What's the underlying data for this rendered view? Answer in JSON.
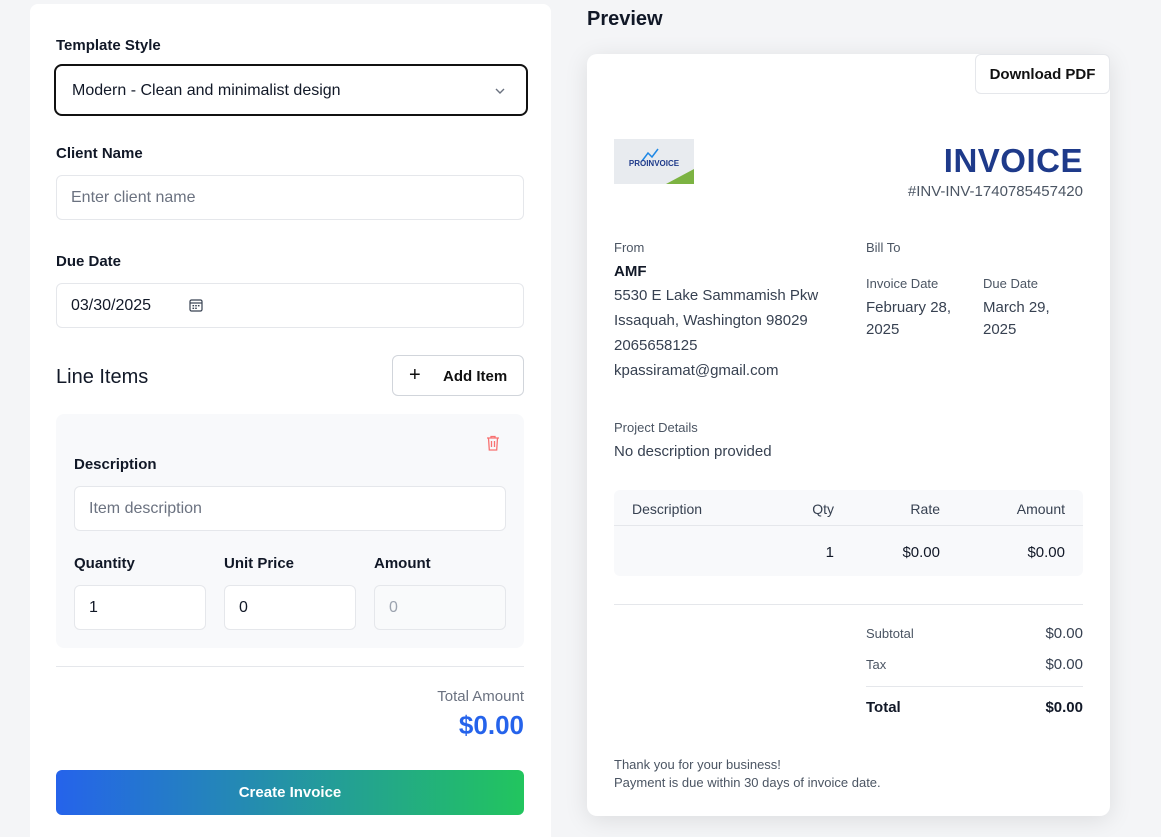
{
  "form": {
    "template_label": "Template Style",
    "template_value": "Modern - Clean and minimalist design",
    "client_label": "Client Name",
    "client_placeholder": "Enter client name",
    "due_label": "Due Date",
    "due_value": "03/30/2025",
    "line_items_title": "Line Items",
    "add_item_label": "Add Item",
    "item": {
      "description_label": "Description",
      "description_placeholder": "Item description",
      "quantity_label": "Quantity",
      "quantity_value": "1",
      "unit_price_label": "Unit Price",
      "unit_price_value": "0",
      "amount_label": "Amount",
      "amount_value": "0"
    },
    "total_label": "Total Amount",
    "total_value": "$0.00",
    "create_label": "Create Invoice"
  },
  "preview": {
    "title": "Preview",
    "download_label": "Download PDF",
    "invoice_title": "INVOICE",
    "invoice_number": "#INV-INV-1740785457420",
    "from_label": "From",
    "from_name": "AMF",
    "from_address1": "5530 E Lake Sammamish Pkw",
    "from_address2": "Issaquah, Washington 98029",
    "from_phone": "2065658125",
    "from_email": "kpassiramat@gmail.com",
    "bill_to_label": "Bill To",
    "invoice_date_label": "Invoice Date",
    "invoice_date_line1": "February 28,",
    "invoice_date_line2": "2025",
    "due_date_label": "Due Date",
    "due_date_line1": "March 29,",
    "due_date_line2": "2025",
    "project_label": "Project Details",
    "project_text": "No description provided",
    "table": {
      "headers": [
        "Description",
        "Qty",
        "Rate",
        "Amount"
      ],
      "rows": [
        {
          "description": "",
          "qty": "1",
          "rate": "$0.00",
          "amount": "$0.00"
        }
      ]
    },
    "subtotal_label": "Subtotal",
    "subtotal_value": "$0.00",
    "tax_label": "Tax",
    "tax_value": "$0.00",
    "total_label": "Total",
    "total_value": "$0.00",
    "footer_line1": "Thank you for your business!",
    "footer_line2": "Payment is due within 30 days of invoice date.",
    "logo_text": "PROINVOICE"
  },
  "colors": {
    "accent_blue": "#2563eb",
    "invoice_navy": "#1e3a8a",
    "gradient_end": "#22c55e",
    "trash_red": "#f87171"
  }
}
